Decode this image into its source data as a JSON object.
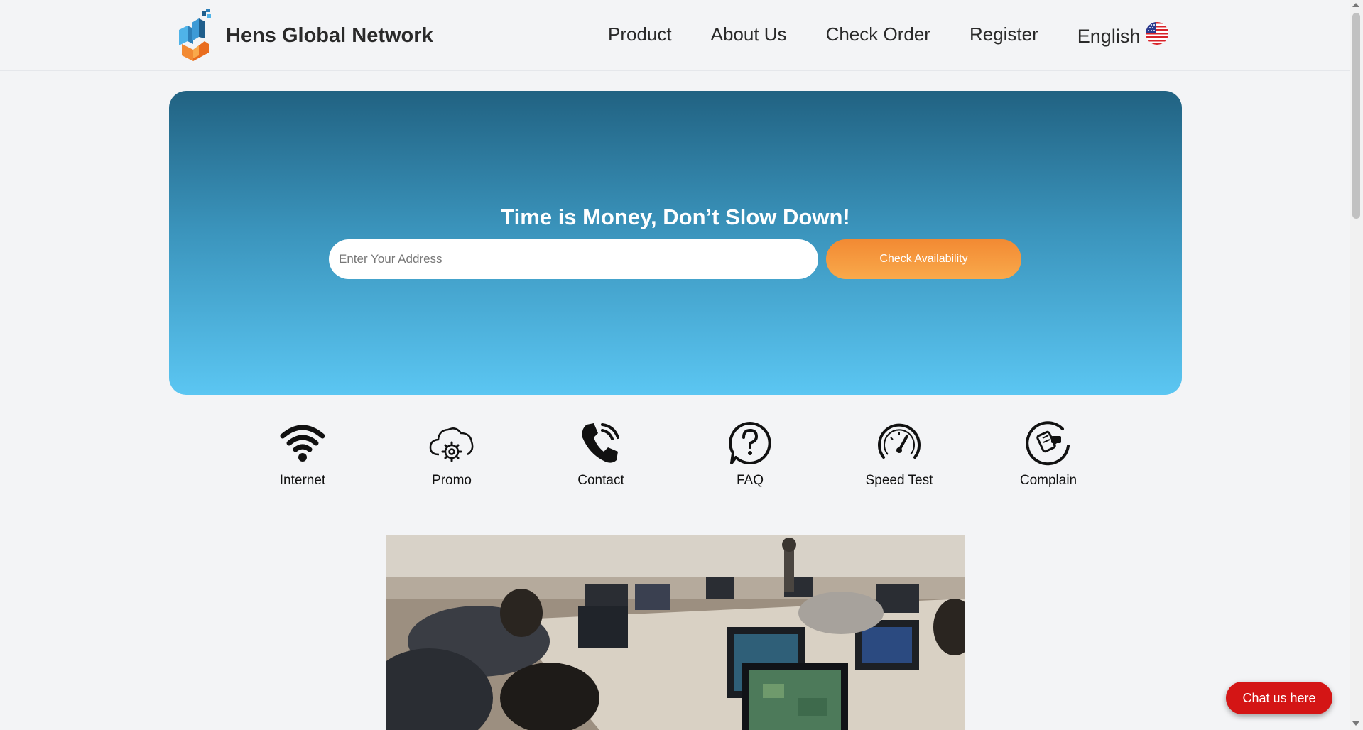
{
  "header": {
    "brand_name": "Hens Global Network",
    "nav": [
      "Product",
      "About Us",
      "Check Order",
      "Register"
    ],
    "language": "English"
  },
  "hero": {
    "title": "Time is Money, Don’t Slow Down!",
    "address_placeholder": "Enter Your Address",
    "address_value": "",
    "check_button": "Check Availability"
  },
  "services": [
    {
      "label": "Internet",
      "icon": "wifi-icon"
    },
    {
      "label": "Promo",
      "icon": "cloud-gear-icon"
    },
    {
      "label": "Contact",
      "icon": "phone-icon"
    },
    {
      "label": "FAQ",
      "icon": "question-bubble-icon"
    },
    {
      "label": "Speed Test",
      "icon": "speedometer-icon"
    },
    {
      "label": "Complain",
      "icon": "complaint-icon"
    }
  ],
  "chat": {
    "label": "Chat us here"
  },
  "colors": {
    "hero_top": "#216282",
    "hero_bottom": "#5bc6f2",
    "accent_orange": "#f28a33",
    "chat_red": "#d41515"
  }
}
